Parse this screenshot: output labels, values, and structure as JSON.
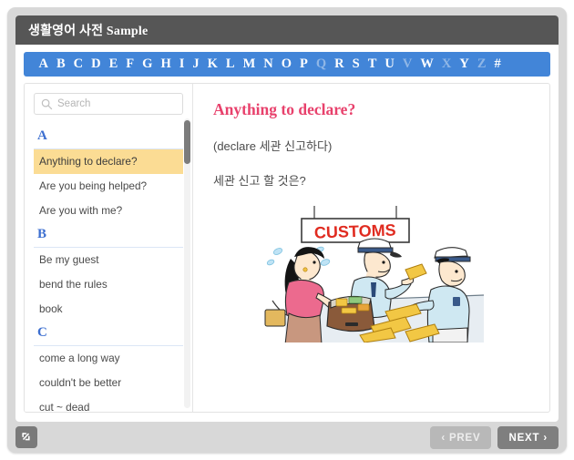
{
  "window": {
    "title": "생활영어 사전 Sample"
  },
  "alphabet": {
    "letters": [
      {
        "label": "A",
        "active": true
      },
      {
        "label": "B",
        "active": true
      },
      {
        "label": "C",
        "active": true
      },
      {
        "label": "D",
        "active": true
      },
      {
        "label": "E",
        "active": true
      },
      {
        "label": "F",
        "active": true
      },
      {
        "label": "G",
        "active": true
      },
      {
        "label": "H",
        "active": true
      },
      {
        "label": "I",
        "active": true
      },
      {
        "label": "J",
        "active": true
      },
      {
        "label": "K",
        "active": true
      },
      {
        "label": "L",
        "active": true
      },
      {
        "label": "M",
        "active": true
      },
      {
        "label": "N",
        "active": true
      },
      {
        "label": "O",
        "active": true
      },
      {
        "label": "P",
        "active": true
      },
      {
        "label": "Q",
        "active": false
      },
      {
        "label": "R",
        "active": true
      },
      {
        "label": "S",
        "active": true
      },
      {
        "label": "T",
        "active": true
      },
      {
        "label": "U",
        "active": true
      },
      {
        "label": "V",
        "active": false
      },
      {
        "label": "W",
        "active": true
      },
      {
        "label": "X",
        "active": false
      },
      {
        "label": "Y",
        "active": true
      },
      {
        "label": "Z",
        "active": false
      },
      {
        "label": "#",
        "active": true
      }
    ]
  },
  "sidebar": {
    "search": {
      "placeholder": "Search",
      "value": "",
      "icon": "search-icon"
    },
    "sections": [
      {
        "letter": "A",
        "entries": [
          {
            "label": "Anything to declare?",
            "selected": true
          },
          {
            "label": "Are you being helped?",
            "selected": false
          },
          {
            "label": "Are you with me?",
            "selected": false
          }
        ]
      },
      {
        "letter": "B",
        "entries": [
          {
            "label": "Be my guest",
            "selected": false
          },
          {
            "label": "bend the rules",
            "selected": false
          },
          {
            "label": "book",
            "selected": false
          }
        ]
      },
      {
        "letter": "C",
        "entries": [
          {
            "label": "come a long way",
            "selected": false
          },
          {
            "label": "couldn't be better",
            "selected": false
          },
          {
            "label": "cut ~ dead",
            "selected": false
          }
        ]
      }
    ]
  },
  "content": {
    "title": "Anything to declare?",
    "gloss": "(declare 세관 신고하다)",
    "translation": "세관 신고 할 것은?",
    "illustration": {
      "sign_text": "CUSTOMS",
      "alt": "customs-counter-cartoon"
    }
  },
  "footer": {
    "resize_icon": "resize-diagonal-icon",
    "prev_label": "PREV",
    "next_label": "NEXT",
    "prev_chevron": "‹",
    "next_chevron": "›"
  },
  "colors": {
    "alphabet_bar": "#4285d8",
    "title_bar": "#565656",
    "accent_title": "#e8416c",
    "selected_entry": "#fbdc94",
    "section_letter": "#3d6fd0",
    "sign_red": "#e02b20",
    "next_button": "#7f7f7f",
    "prev_button": "#b8b8b8"
  }
}
